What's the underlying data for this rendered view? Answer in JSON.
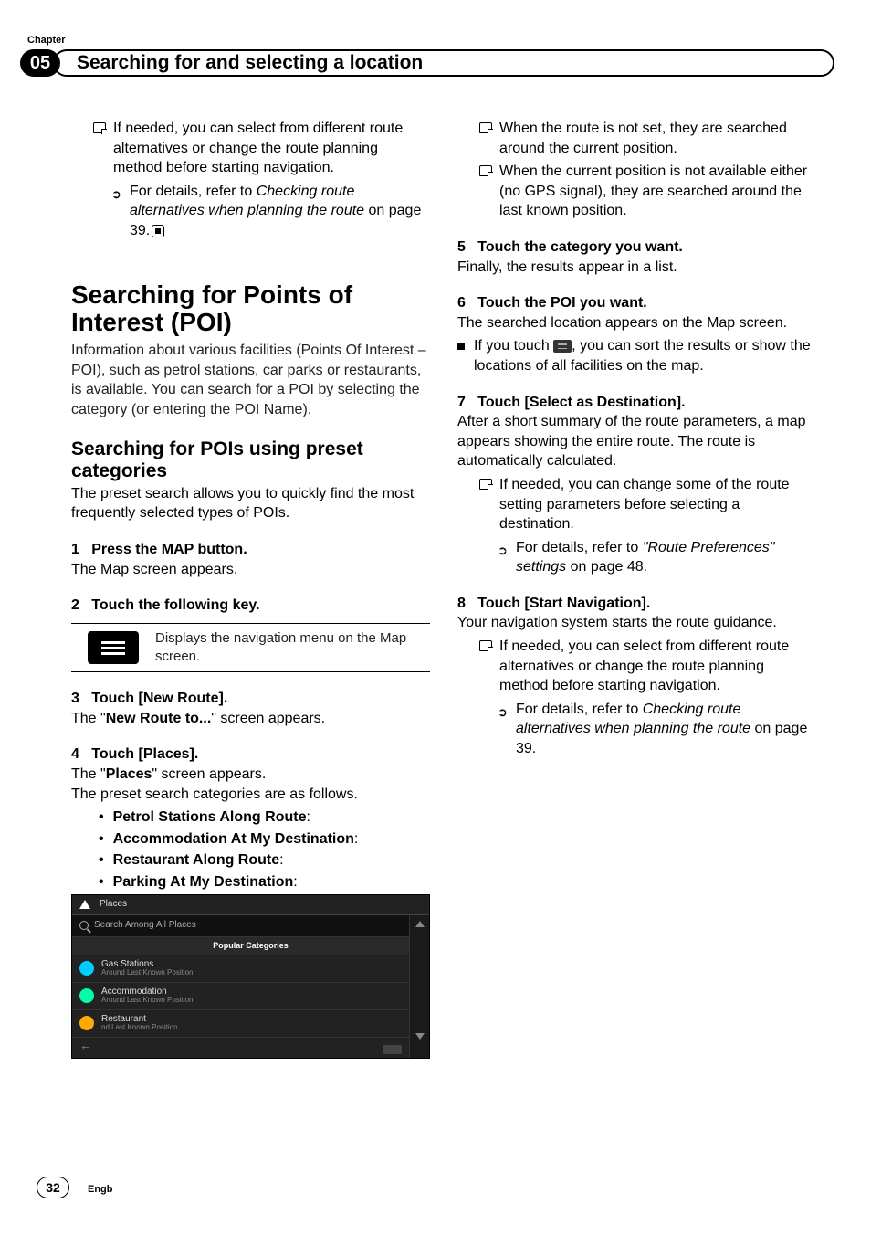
{
  "header": {
    "chapter_label": "Chapter",
    "chapter_number": "05",
    "title": "Searching for and selecting a location"
  },
  "col1": {
    "tip1": "If needed, you can select from different route alternatives or change the route planning method before starting navigation.",
    "tip1_ref_pre": "For details, refer to ",
    "tip1_ref_italic": "Checking route alternatives when planning the route",
    "tip1_ref_post": " on page 39.",
    "h1": "Searching for Points of Interest (POI)",
    "h1_intro": "Information about various facilities (Points Of Interest – POI), such as petrol stations, car parks or restaurants, is available. You can search for a POI by selecting the category (or entering the POI Name).",
    "h2": "Searching for POIs using preset categories",
    "h2_intro": "The preset search allows you to quickly find the most frequently selected types of POIs.",
    "step1_num": "1",
    "step1_head": "Press the MAP button.",
    "step1_body": "The Map screen appears.",
    "step2_num": "2",
    "step2_head": "Touch the following key.",
    "step2_key_desc": "Displays the navigation menu on the Map screen.",
    "step3_num": "3",
    "step3_head": "Touch [New Route].",
    "step3_body_pre": "The \"",
    "step3_body_bold": "New Route to...",
    "step3_body_post": "\" screen appears.",
    "step4_num": "4",
    "step4_head": "Touch [Places].",
    "step4_body_pre": "The \"",
    "step4_body_bold": "Places",
    "step4_body_post": "\" screen appears.",
    "step4_extra": "The preset search categories are as follows.",
    "bullets": {
      "b1": "Petrol Stations Along Route",
      "b2": "Accommodation At My Destination",
      "b3": "Restaurant Along Route",
      "b4": "Parking At My Destination"
    }
  },
  "screenshot": {
    "title": "Places",
    "search": "Search Among All Places",
    "popcat": "Popular Categories",
    "row1_title": "Gas Stations",
    "row1_sub": "Around Last Known Position",
    "row2_title": "Accommodation",
    "row2_sub": "Around Last Known Position",
    "row3_title": "Restaurant",
    "row3_sub": "nd Last Known Position"
  },
  "col2": {
    "tipA": "When the route is not set, they are searched around the current position.",
    "tipB": "When the current position is not available either (no GPS signal), they are searched around the last known position.",
    "step5_num": "5",
    "step5_head": "Touch the category you want.",
    "step5_body": "Finally, the results appear in a list.",
    "step6_num": "6",
    "step6_head": "Touch the POI you want.",
    "step6_body": "The searched location appears on the Map screen.",
    "step6_sq_pre": "If you touch ",
    "step6_sq_post": ", you can sort the results or show the locations of all facilities on the map.",
    "step7_num": "7",
    "step7_head": "Touch [Select as Destination].",
    "step7_body": "After a short summary of the route parameters, a map appears showing the entire route. The route is automatically calculated.",
    "step7_tip": "If needed, you can change some of the route setting parameters before selecting a destination.",
    "step7_ref_pre": "For details, refer to ",
    "step7_ref_italic": "\"Route Preferences\" settings",
    "step7_ref_post": " on page 48.",
    "step8_num": "8",
    "step8_head": "Touch [Start Navigation].",
    "step8_body": "Your navigation system starts the route guidance.",
    "step8_tip": "If needed, you can select from different route alternatives or change the route planning method before starting navigation.",
    "step8_ref_pre": "For details, refer to ",
    "step8_ref_italic": "Checking route alternatives when planning the route",
    "step8_ref_post": " on page 39."
  },
  "footer": {
    "page": "32",
    "lang": "Engb"
  }
}
